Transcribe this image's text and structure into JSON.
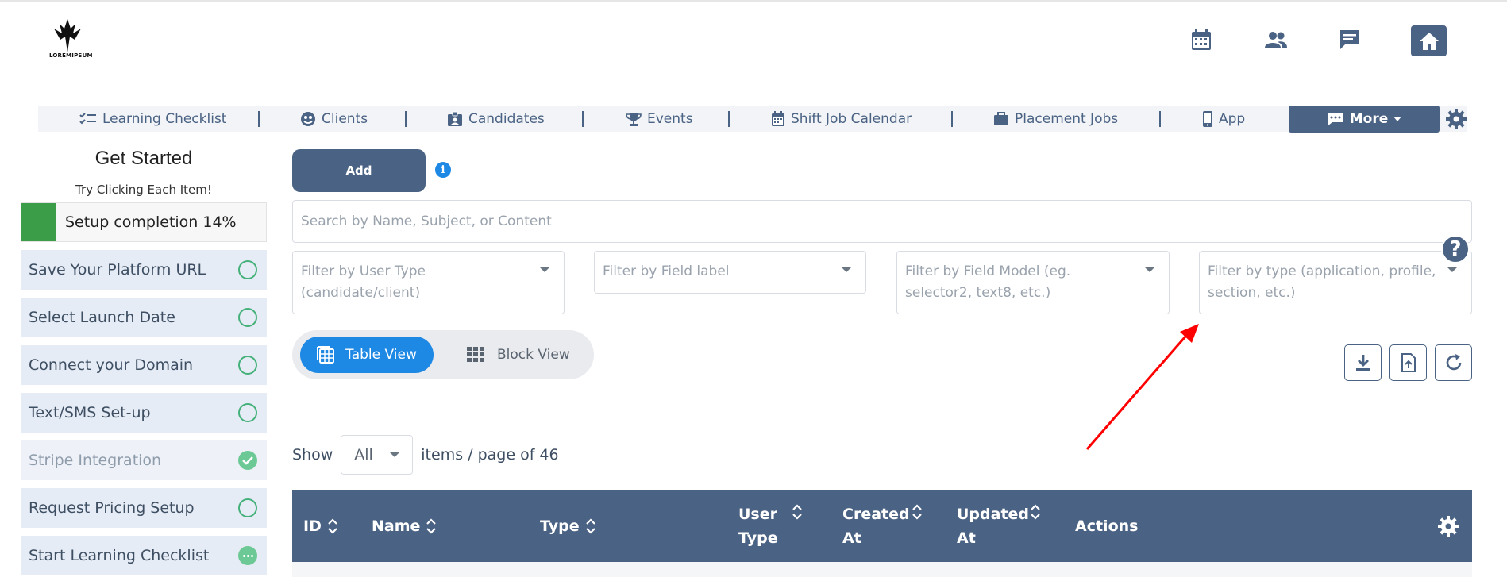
{
  "brand": {
    "logo_text": "LOREMIPSUM"
  },
  "header_icons": [
    "calendar-icon",
    "users-icon",
    "chat-icon",
    "home-icon"
  ],
  "nav": {
    "items": [
      {
        "label": "Learning Checklist",
        "icon": "checklist-icon"
      },
      {
        "label": "Clients",
        "icon": "clients-icon"
      },
      {
        "label": "Candidates",
        "icon": "id-card-icon"
      },
      {
        "label": "Events",
        "icon": "trophy-icon"
      },
      {
        "label": "Shift Job Calendar",
        "icon": "calendar-icon"
      },
      {
        "label": "Placement Jobs",
        "icon": "briefcase-icon"
      },
      {
        "label": "App",
        "icon": "mobile-icon"
      }
    ],
    "more_label": "More"
  },
  "sidebar": {
    "title": "Get Started",
    "subtitle": "Try Clicking Each Item!",
    "progress_label": "Setup completion 14%",
    "progress_percent": 14,
    "items": [
      {
        "label": "Save Your Platform URL",
        "status": "pending"
      },
      {
        "label": "Select Launch Date",
        "status": "pending"
      },
      {
        "label": "Connect your Domain",
        "status": "pending"
      },
      {
        "label": "Text/SMS Set-up",
        "status": "pending"
      },
      {
        "label": "Stripe Integration",
        "status": "done"
      },
      {
        "label": "Request Pricing Setup",
        "status": "pending"
      },
      {
        "label": "Start Learning Checklist",
        "status": "in-progress"
      }
    ]
  },
  "main": {
    "add_label": "Add",
    "search_placeholder": "Search by Name, Subject, or Content",
    "filters": [
      "Filter by User Type (candidate/client)",
      "Filter by Field label",
      "Filter by Field Model (eg. selector2, text8, etc.)",
      "Filter by type (application, profile, section, etc.)"
    ],
    "view": {
      "table_label": "Table View",
      "block_label": "Block View",
      "active": "table"
    },
    "pagination": {
      "show_label": "Show",
      "per_page": "All",
      "suffix": "items / page of 46"
    },
    "table": {
      "columns": [
        "ID",
        "Name",
        "Type",
        "User Type",
        "Created At",
        "Updated At",
        "Actions"
      ]
    }
  },
  "colors": {
    "primary": "#4a6283",
    "accent": "#1e88e5",
    "success": "#45b17a",
    "progress": "#3c9d48",
    "annotation": "#ff0000"
  }
}
